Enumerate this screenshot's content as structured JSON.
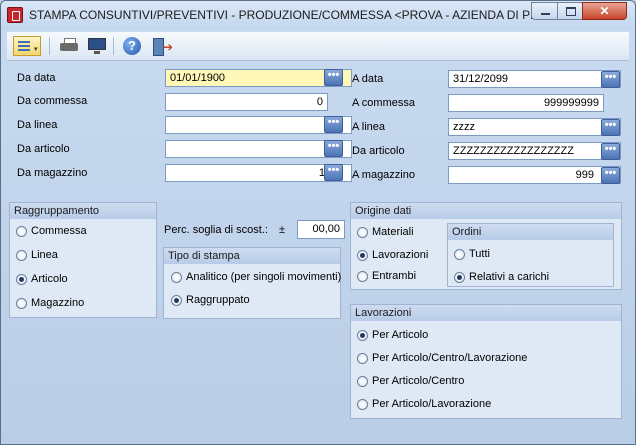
{
  "window": {
    "title": "STAMPA CONSUNTIVI/PREVENTIVI - PRODUZIONE/COMMESSA <PROVA - AZIENDA DI PR...",
    "close_glyph": "✕"
  },
  "toolbar": {
    "help_glyph": "?",
    "dropdown_glyph": "▾",
    "exit_glyph": "➔"
  },
  "picker_glyph": "•••",
  "left": {
    "da_data": {
      "label": "Da data",
      "value": "01/01/1900"
    },
    "da_commessa": {
      "label": "Da commessa",
      "value": "0"
    },
    "da_linea": {
      "label": "Da linea",
      "value": ""
    },
    "da_articolo": {
      "label": "Da articolo",
      "value": ""
    },
    "da_magazzino": {
      "label": "Da magazzino",
      "value": "1"
    }
  },
  "right": {
    "a_data": {
      "label": "A data",
      "value": "31/12/2099"
    },
    "a_commessa": {
      "label": "A commessa",
      "value": "999999999"
    },
    "a_linea": {
      "label": "A linea",
      "value": "zzzz"
    },
    "a_articolo": {
      "label": "Da articolo",
      "value": "ZZZZZZZZZZZZZZZZZZ"
    },
    "a_magazzino": {
      "label": "A magazzino",
      "value": "999"
    }
  },
  "raggruppamento": {
    "title": "Raggruppamento",
    "options": [
      "Commessa",
      "Linea",
      "Articolo",
      "Magazzino"
    ],
    "selected": "Articolo"
  },
  "soglia": {
    "label": "Perc. soglia di scost.:",
    "sign": "±",
    "value": "00,00"
  },
  "tipo_stampa": {
    "title": "Tipo di stampa",
    "options": [
      "Analitico (per singoli movimenti)",
      "Raggruppato"
    ],
    "selected": "Raggruppato"
  },
  "origine_dati": {
    "title": "Origine dati",
    "options": [
      "Materiali",
      "Lavorazioni",
      "Entrambi"
    ],
    "selected": "Lavorazioni"
  },
  "ordini": {
    "title": "Ordini",
    "options": [
      "Tutti",
      "Relativi a carichi"
    ],
    "selected": "Relativi a carichi"
  },
  "lavorazioni": {
    "title": "Lavorazioni",
    "options": [
      "Per Articolo",
      "Per Articolo/Centro/Lavorazione",
      "Per Articolo/Centro",
      "Per Articolo/Lavorazione"
    ],
    "selected": "Per Articolo"
  }
}
